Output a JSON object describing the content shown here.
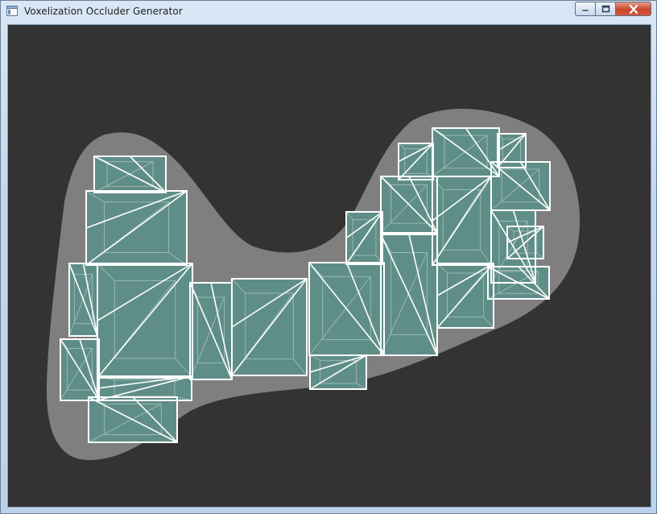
{
  "window": {
    "title": "Voxelization Occluder Generator",
    "controls": [
      "minimize",
      "maximize",
      "close"
    ]
  },
  "viewport": {
    "background_color": "#333333",
    "mesh_color": "#7f7f7f",
    "box_fill_color": "#5f8e88",
    "edge_color": "#ffffff"
  },
  "icons": [
    "app-icon",
    "minimize-icon",
    "maximize-icon",
    "close-icon"
  ]
}
